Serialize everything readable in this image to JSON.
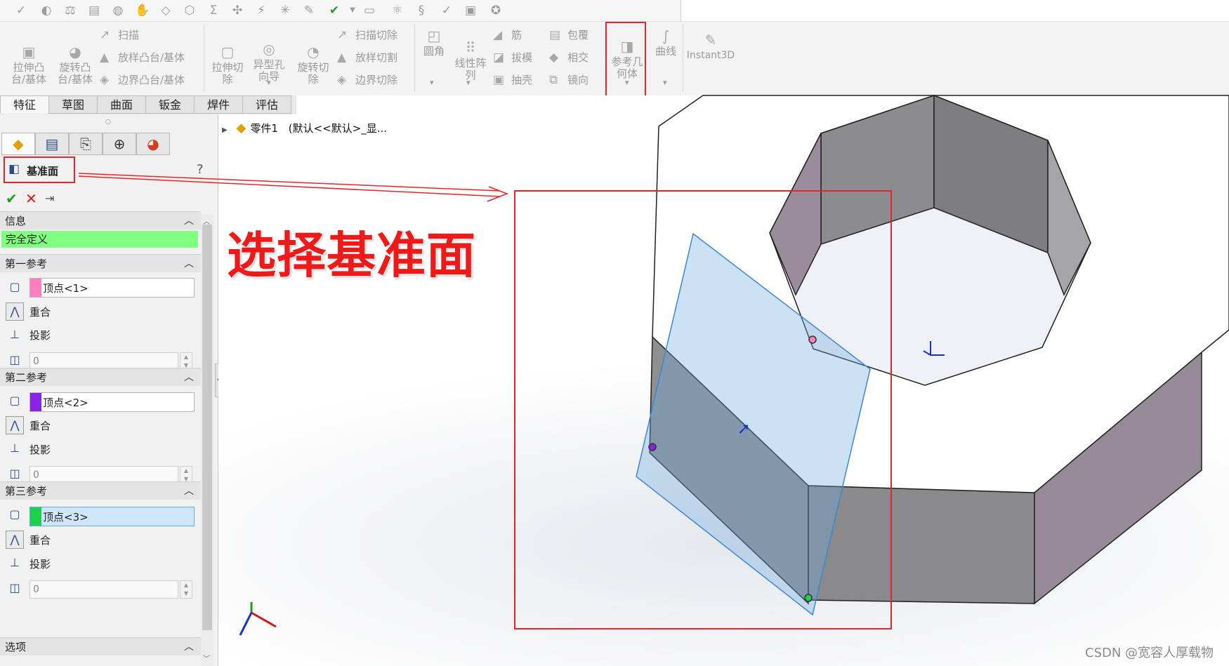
{
  "quick_toolbar": {
    "icons": [
      "spellcheck-icon",
      "sketch-picture-icon",
      "balance-icon",
      "note-icon",
      "globe-icon",
      "hand-icon",
      "cube-icon",
      "shield-check-icon",
      "sigma-icon",
      "check-xyz-icon",
      "measure-icon",
      "asterisk-icon",
      "edit-icon",
      "dropdown-tool-icon",
      "chevron-down-icon",
      "screen-icon",
      "molecule-icon",
      "spring-icon",
      "check-circle-icon",
      "layers-icon",
      "settings-circle-icon"
    ]
  },
  "ribbon": {
    "extrude_boss": "拉伸凸\n台/基体",
    "revolve_boss": "旋转凸\n台/基体",
    "sweep": "扫描",
    "loft_boss": "放样凸台/基体",
    "boundary_boss": "边界凸台/基体",
    "extrude_cut": "拉伸切\n除",
    "hole_wizard": "异型孔\n向导",
    "revolve_cut": "旋转切\n除",
    "sweep_cut": "扫描切除",
    "loft_cut": "放样切割",
    "boundary_cut": "边界切除",
    "fillet": "圆角",
    "linear_pattern": "线性阵\n列",
    "rib": "筋",
    "draft": "拔模",
    "shell": "抽壳",
    "wrap": "包覆",
    "intersect": "相交",
    "mirror": "镜向",
    "reference_geometry": "参考几\n何体",
    "curves": "曲线",
    "instant3d": "Instant3D"
  },
  "tabs": [
    "特征",
    "草图",
    "曲面",
    "钣金",
    "焊件",
    "评估"
  ],
  "panel": {
    "title": "基准面",
    "help": "?",
    "sections": {
      "info": {
        "title": "信息",
        "status": "完全定义"
      },
      "first": {
        "title": "第一参考",
        "ref": "顶点<1>",
        "coincident": "重合",
        "project": "投影",
        "value": "0"
      },
      "second": {
        "title": "第二参考",
        "ref": "顶点<2>",
        "coincident": "重合",
        "project": "投影",
        "value": "0"
      },
      "third": {
        "title": "第三参考",
        "ref": "顶点<3>",
        "coincident": "重合",
        "project": "投影",
        "value": "0"
      },
      "options": {
        "title": "选项"
      }
    },
    "colors": {
      "ref1": "#ff7fbf",
      "ref2": "#8a22e6",
      "ref3": "#1fd04a",
      "status_bg": "#80ff80",
      "ok": "#1aa01a",
      "cancel": "#e01a1a"
    }
  },
  "tree": {
    "part": "零件1",
    "config": "(默认<<默认>_显..."
  },
  "annotation": {
    "title": "选择基准面",
    "color": "#ee1a1a"
  },
  "watermark": "CSDN @宽容人厚载物"
}
